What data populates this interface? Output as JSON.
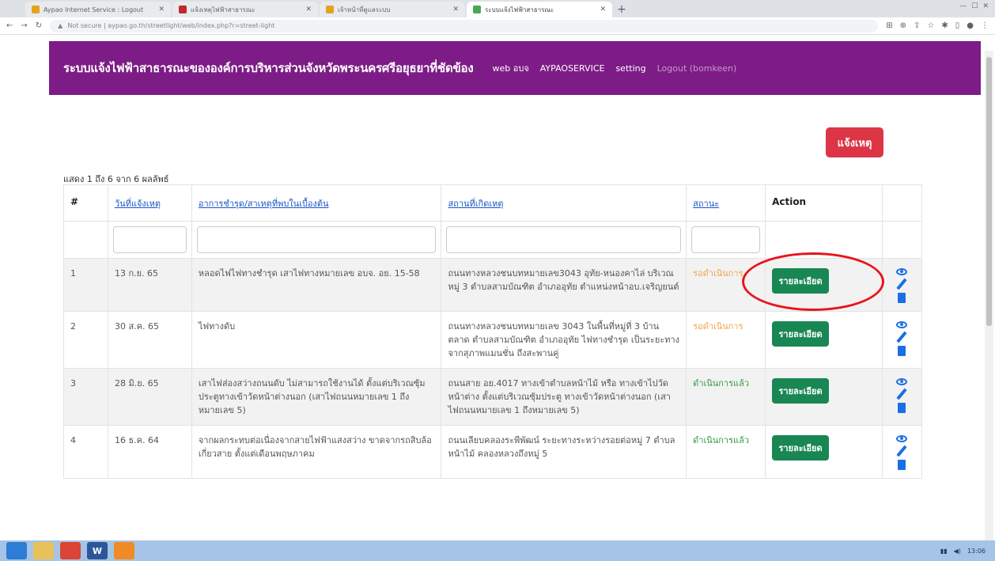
{
  "browser": {
    "tabs": [
      {
        "title": "Aypao Internet Service : Logout",
        "color": "#e2a31d",
        "active": false
      },
      {
        "title": "แจ้งเหตุไฟฟ้าสาธารณะ",
        "color": "#c0282d",
        "active": false
      },
      {
        "title": "เจ้าหน้าที่ดูแลระบบ",
        "color": "#e2a31d",
        "active": false
      },
      {
        "title": "ระบบแจ้งไฟฟ้าสาธารณะ",
        "color": "#4aa657",
        "active": true
      }
    ],
    "new_tab": "+",
    "url": "Not secure | aypao.go.th/streetlight/web/index.php?r=street-light"
  },
  "header": {
    "title": "ระบบแจ้งไฟฟ้าสาธารณะขององค์การบริหารส่วนจังหวัดพระนครศรีอยุธยาที่ชัดข้อง",
    "nav": [
      {
        "label": "web อบจ",
        "muted": false
      },
      {
        "label": "AYPAOSERVICE",
        "muted": false
      },
      {
        "label": "setting",
        "muted": false
      },
      {
        "label": "Logout (bomkeen)",
        "muted": true
      }
    ]
  },
  "report_button": "แจ้งเหตุ",
  "summary": "แสดง 1 ถึง 6 จาก 6 ผลลัพธ์",
  "table": {
    "headers": {
      "num": "#",
      "date": "วันที่แจ้งเหตุ",
      "symptom": "อาการชำรุด/สาเหตุที่พบในเบื้องต้น",
      "location": "สถานที่เกิดเหตุ",
      "status": "สถานะ",
      "action": "Action"
    },
    "detail_label": "รายละเอียด",
    "rows": [
      {
        "num": "1",
        "date": "13 ก.ย. 65",
        "symptom": "หลอดไฟไฟทางชำรุด เสาไฟทางหมายเลข อบจ. อย. 15-58",
        "location": "ถนนทางหลวงชนบทหมายเลข3043 อุทัย-หนองคาไล่ บริเวณหมู่ 3 ตำบลสามบัณฑิต อำเภออุทัย ตำแหน่งหน้าอบ.เจริญยนต์",
        "status": "รอดำเนินการ",
        "status_type": "wait"
      },
      {
        "num": "2",
        "date": "30 ส.ค. 65",
        "symptom": "ไฟทางดับ",
        "location": "ถนนทางหลวงชนบทหมายเลข 3043 ในพื้นที่หมู่ที่ 3 บ้านตลาด ตำบลสามบัณฑิต อำเภออุทัย ไฟทางชำรุด เป็นระยะทางจากสุภาพแมนชั่น ถึงสะพานคู่",
        "status": "รอดำเนินการ",
        "status_type": "wait"
      },
      {
        "num": "3",
        "date": "28 มิ.ย. 65",
        "symptom": "เสาไฟส่องสว่างถนนดับ ไม่สามารถใช้งานได้ ตั้งแต่บริเวณซุ้มประตูทางเข้าวัดหน้าต่างนอก (เสาไฟถนนหมายเลข 1 ถึงหมายเลข 5)",
        "location": "ถนนสาย อย.4017 ทางเข้าตำบลหน้าไม้ หรือ ทางเข้าไปวัดหน้าต่าง ตั้งแต่บริเวณซุ้มประตู ทางเข้าวัดหน้าต่างนอก (เสาไฟถนนหมายเลข 1 ถึงหมายเลข 5)",
        "status": "ดำเนินการแล้ว",
        "status_type": "done"
      },
      {
        "num": "4",
        "date": "16 ธ.ค. 64",
        "symptom": "จากผลกระทบต่อเนื่องจากสายไฟฟ้าแสงสว่าง ขาดจากรถสิบล้อเกี่ยวสาย ตั้งแต่เดือนพฤษภาคม",
        "location": "ถนนเลียบคลองระพีพัฒน์ ระยะทางระหว่างรอยต่อหมู่ 7 ตำบลหน้าไม้ คลองหลวงถึงหมู่ 5",
        "status": "ดำเนินการแล้ว",
        "status_type": "done"
      }
    ]
  },
  "taskbar": {
    "items": [
      {
        "icon": "windows-icon",
        "label": "",
        "color": "#2d7cd6"
      },
      {
        "icon": "explorer-icon",
        "label": "",
        "color": "#e8c15a"
      },
      {
        "icon": "chrome-icon",
        "label": "",
        "color": "#db4437"
      },
      {
        "icon": "word-icon",
        "label": "W",
        "color": "#2b579a"
      },
      {
        "icon": "app-icon",
        "label": "",
        "color": "#f08a24"
      }
    ],
    "clock": "13:06"
  }
}
